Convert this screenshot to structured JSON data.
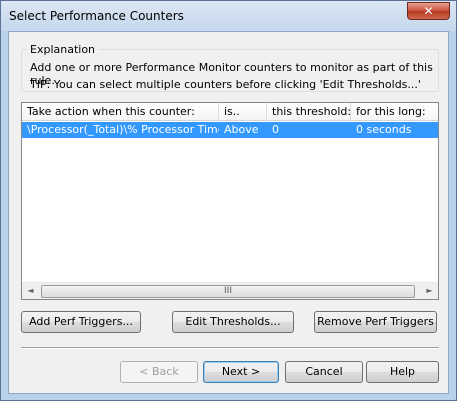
{
  "window": {
    "title": "Select Performance Counters",
    "close_glyph": "✕"
  },
  "explanation": {
    "legend": "Explanation",
    "line1": "Add one or more Performance Monitor counters to monitor as part of this rule.",
    "line2": "TIP:  You can select multiple counters before clicking 'Edit Thresholds...'"
  },
  "counters_list": {
    "columns": [
      "Take action when this counter:",
      "is..",
      "this threshold:",
      "for this long:"
    ],
    "rows": [
      {
        "counter": "\\Processor(_Total)\\% Processor Time",
        "is": "Above",
        "threshold": "0",
        "duration": "0 seconds",
        "selected": true
      }
    ],
    "scroll_left_glyph": "◄",
    "scroll_right_glyph": "►",
    "scroll_thumb_grip": "III"
  },
  "actions": {
    "add_label": "Add Perf Triggers...",
    "edit_label": "Edit Thresholds...",
    "remove_label": "Remove Perf Triggers"
  },
  "navigation": {
    "back_label": "< Back",
    "next_label": "Next >",
    "cancel_label": "Cancel",
    "help_label": "Help"
  },
  "colors": {
    "selection": "#3399ff",
    "dialog_bg": "#f0f0f0",
    "frame": "#b9d1ea"
  }
}
